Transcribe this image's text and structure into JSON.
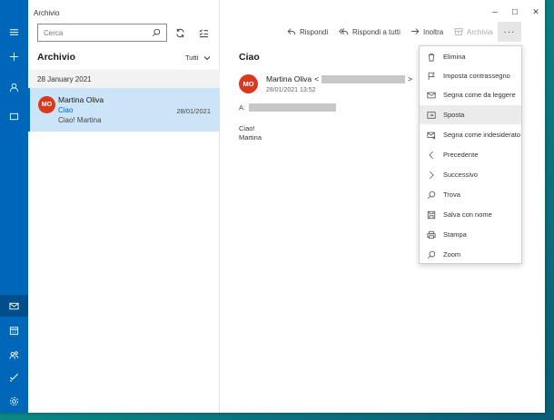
{
  "window": {
    "title": "Archivio",
    "controls": [
      "–",
      "☐",
      "✕"
    ]
  },
  "rail": {
    "icons": [
      "hamburger-icon",
      "plus-icon",
      "person-icon",
      "folder-icon",
      "mail-icon",
      "calendar-icon",
      "people-icon",
      "todo-icon",
      "settings-icon"
    ]
  },
  "list": {
    "search_placeholder": "Cerca",
    "folder_title": "Archivio",
    "filter_label": "Tutti",
    "date_group": "28 January 2021",
    "items": [
      {
        "initials": "MO",
        "sender": "Martina Oliva",
        "subject": "Ciao",
        "preview": "Ciao! Martina",
        "date": "28/01/2021"
      }
    ]
  },
  "toolbar": {
    "reply": "Rispondi",
    "reply_all": "Rispondi a tutti",
    "forward": "Inoltra",
    "archive": "Archivia",
    "more": "···"
  },
  "message": {
    "subject": "Ciao",
    "initials": "MO",
    "sender": "Martina Oliva",
    "open_bracket": "<",
    "close_bracket": ">",
    "date": "28/01/2021 13:52",
    "to_label": "A:",
    "body_lines": [
      "Ciao!",
      "Martina"
    ]
  },
  "menu": {
    "items": [
      {
        "label": "Elimina",
        "icon": "trash-icon"
      },
      {
        "label": "Imposta contrassegno",
        "icon": "flag-icon"
      },
      {
        "label": "Segna come da leggere",
        "icon": "envelope-icon"
      },
      {
        "label": "Sposta",
        "icon": "move-icon"
      },
      {
        "label": "Segna come indesiderato",
        "icon": "junk-icon"
      },
      {
        "label": "Precedente",
        "icon": "chevron-left-icon"
      },
      {
        "label": "Successivo",
        "icon": "chevron-right-icon"
      },
      {
        "label": "Trova",
        "icon": "search-icon"
      },
      {
        "label": "Salva con nome",
        "icon": "save-icon"
      },
      {
        "label": "Stampa",
        "icon": "print-icon"
      },
      {
        "label": "Zoom",
        "icon": "zoom-icon"
      }
    ]
  }
}
